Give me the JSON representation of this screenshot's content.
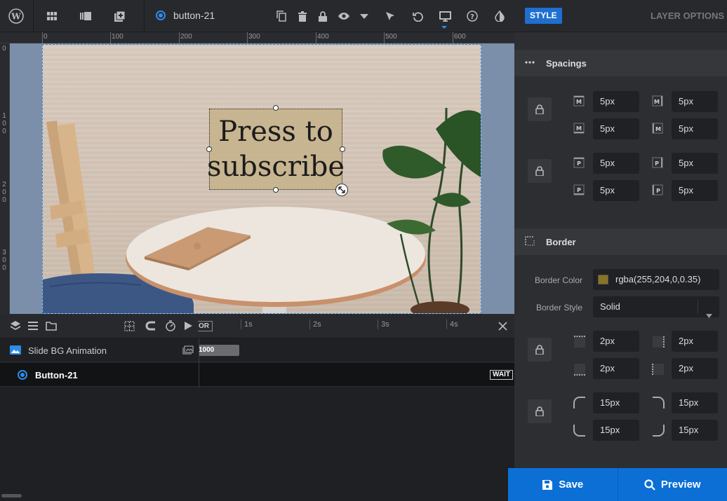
{
  "toolbar": {
    "layer_name": "button-21",
    "icons": [
      "wordpress-icon",
      "grid-icon",
      "slides-icon",
      "add-slide-icon",
      "duplicate-icon",
      "delete-icon",
      "lock-icon",
      "visibility-icon",
      "dropdown-icon",
      "pointer-icon",
      "undo-icon",
      "desktop-icon",
      "help-icon",
      "contrast-icon"
    ]
  },
  "ruler": {
    "top_labels": [
      "0",
      "100",
      "200",
      "300",
      "400",
      "500",
      "600"
    ],
    "left_labels": [
      "0",
      "1\n0\n0",
      "2\n0\n0",
      "3\n0\n0"
    ]
  },
  "canvas": {
    "button_text_line1": "Press to",
    "button_text_line2": "subscribe"
  },
  "timeline": {
    "time_marks": [
      "1s",
      "2s",
      "3s",
      "4s"
    ],
    "partial_label": "OR",
    "rows": [
      {
        "label": "Slide BG Animation",
        "bar_value": "1000"
      },
      {
        "label": "Button-21",
        "badge": "WAIT"
      }
    ]
  },
  "panel": {
    "tab_style": "STYLE",
    "tab_layer": "LAYER OPTIONS",
    "spacings": {
      "title": "Spacings",
      "margin": [
        "5px",
        "5px",
        "5px",
        "5px"
      ],
      "padding": [
        "5px",
        "5px",
        "5px",
        "5px"
      ]
    },
    "border": {
      "title": "Border",
      "color_label": "Border Color",
      "color_value": "rgba(255,204,0,0.35)",
      "swatch": "#8a7423",
      "style_label": "Border Style",
      "style_value": "Solid",
      "width": [
        "2px",
        "2px",
        "2px",
        "2px"
      ],
      "radius": [
        "15px",
        "15px",
        "15px",
        "15px"
      ]
    }
  },
  "actions": {
    "save": "Save",
    "preview": "Preview"
  },
  "colors": {
    "accent": "#1e6fd0",
    "action": "#0b6fd6"
  }
}
